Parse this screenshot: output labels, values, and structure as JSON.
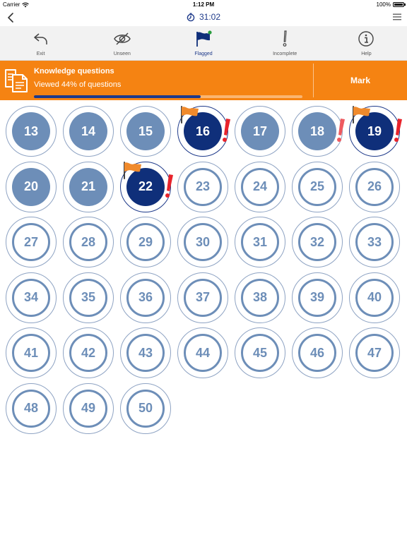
{
  "status_bar": {
    "carrier": "Carrier",
    "time": "1:12 PM",
    "battery": "100%"
  },
  "navbar": {
    "timer": "31:02"
  },
  "toolbar": [
    {
      "label": "Exit",
      "icon": "undo-arrow-icon"
    },
    {
      "label": "Unseen",
      "icon": "eye-slash-icon"
    },
    {
      "label": "Flagged",
      "icon": "flag-icon",
      "active": true
    },
    {
      "label": "Incomplete",
      "icon": "exclamation-icon"
    },
    {
      "label": "Help",
      "icon": "info-icon"
    }
  ],
  "banner": {
    "title": "Knowledge questions",
    "subtitle": "Viewed 44% of questions",
    "progress": 0.62,
    "mark_label": "Mark"
  },
  "colors": {
    "orange": "#f58312",
    "navy": "#0f2f7a",
    "blue_light": "#6d8eb8"
  },
  "questions": [
    {
      "n": "13",
      "state": "seen"
    },
    {
      "n": "14",
      "state": "seen"
    },
    {
      "n": "15",
      "state": "seen"
    },
    {
      "n": "16",
      "state": "flagged",
      "flag": true,
      "alert": true
    },
    {
      "n": "17",
      "state": "seen"
    },
    {
      "n": "18",
      "state": "seen",
      "alert": true
    },
    {
      "n": "19",
      "state": "flagged",
      "flag": true,
      "alert": true
    },
    {
      "n": "20",
      "state": "seen"
    },
    {
      "n": "21",
      "state": "seen"
    },
    {
      "n": "22",
      "state": "flagged",
      "flag": true,
      "alert": true
    },
    {
      "n": "23",
      "state": "unseen"
    },
    {
      "n": "24",
      "state": "unseen"
    },
    {
      "n": "25",
      "state": "unseen"
    },
    {
      "n": "26",
      "state": "unseen"
    },
    {
      "n": "27",
      "state": "unseen"
    },
    {
      "n": "28",
      "state": "unseen"
    },
    {
      "n": "29",
      "state": "unseen"
    },
    {
      "n": "30",
      "state": "unseen"
    },
    {
      "n": "31",
      "state": "unseen"
    },
    {
      "n": "32",
      "state": "unseen"
    },
    {
      "n": "33",
      "state": "unseen"
    },
    {
      "n": "34",
      "state": "unseen"
    },
    {
      "n": "35",
      "state": "unseen"
    },
    {
      "n": "36",
      "state": "unseen"
    },
    {
      "n": "37",
      "state": "unseen"
    },
    {
      "n": "38",
      "state": "unseen"
    },
    {
      "n": "39",
      "state": "unseen"
    },
    {
      "n": "40",
      "state": "unseen"
    },
    {
      "n": "41",
      "state": "unseen"
    },
    {
      "n": "42",
      "state": "unseen"
    },
    {
      "n": "43",
      "state": "unseen"
    },
    {
      "n": "44",
      "state": "unseen"
    },
    {
      "n": "45",
      "state": "unseen"
    },
    {
      "n": "46",
      "state": "unseen"
    },
    {
      "n": "47",
      "state": "unseen"
    },
    {
      "n": "48",
      "state": "unseen"
    },
    {
      "n": "49",
      "state": "unseen"
    },
    {
      "n": "50",
      "state": "unseen"
    }
  ]
}
